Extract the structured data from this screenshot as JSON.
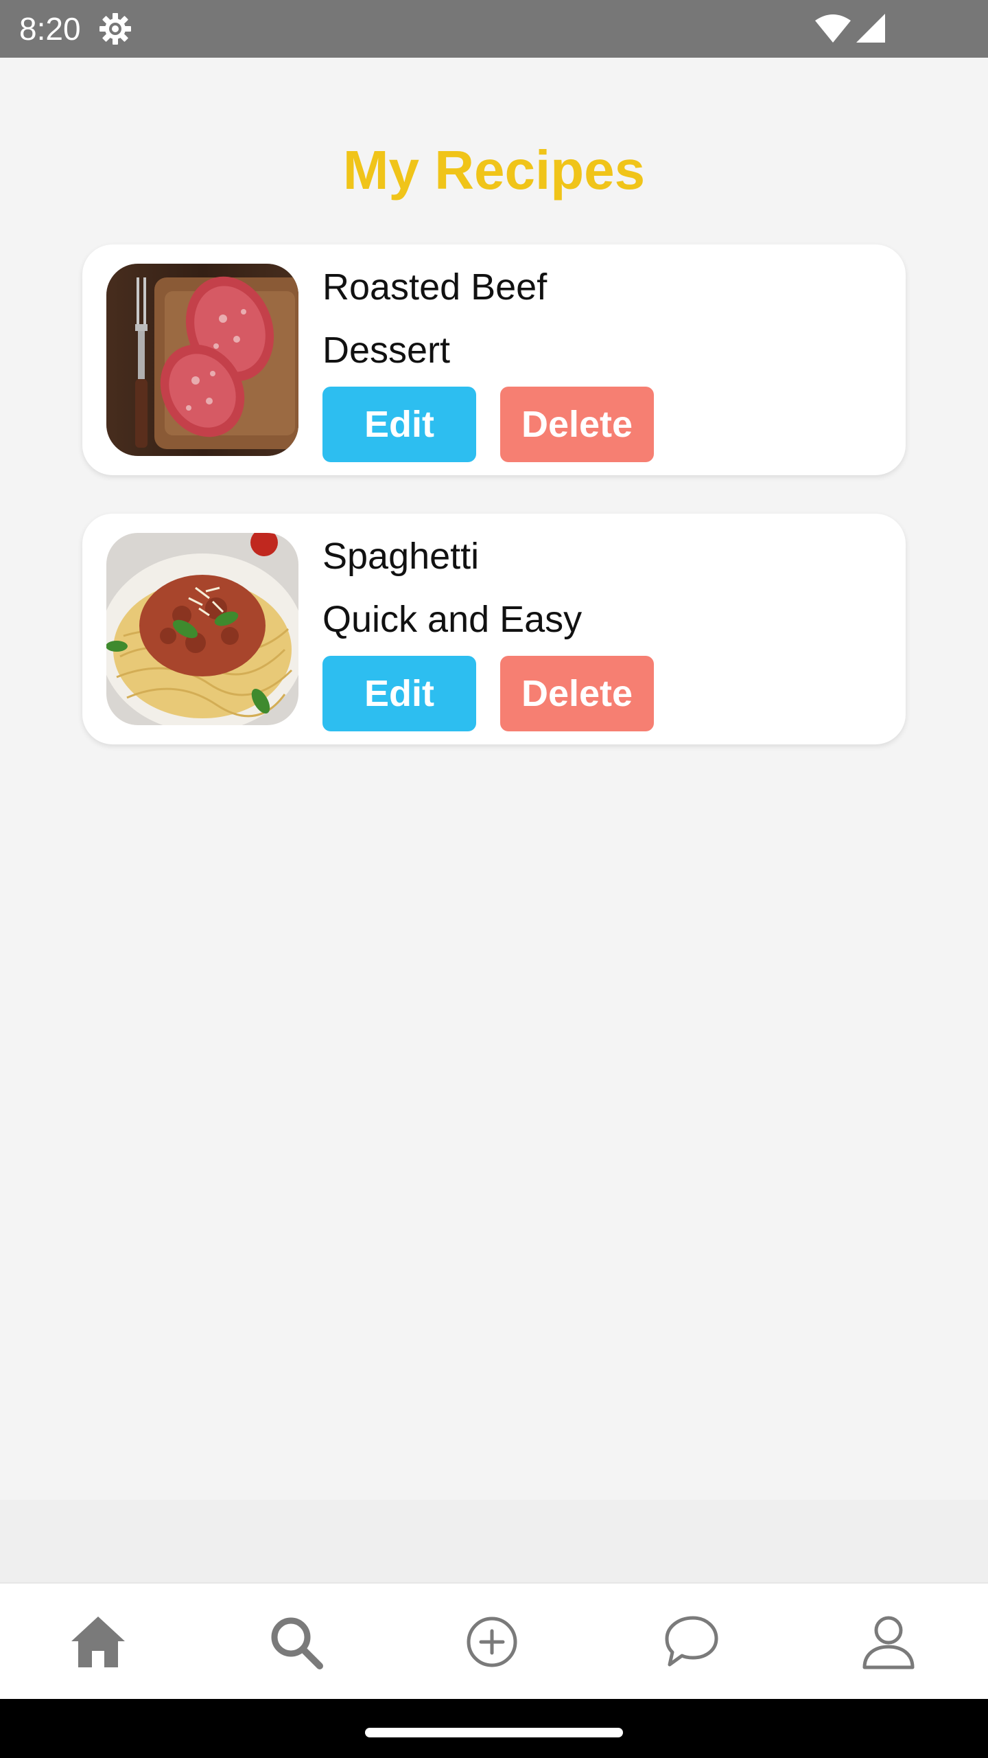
{
  "status_bar": {
    "time": "8:20",
    "icons": [
      "gear-icon",
      "wifi-icon",
      "signal-icon"
    ]
  },
  "page": {
    "title": "My Recipes",
    "title_color": "#f0c419"
  },
  "recipes": [
    {
      "name": "Roasted Beef",
      "category": "Dessert",
      "image": "raw-steaks-on-board",
      "edit_label": "Edit",
      "delete_label": "Delete"
    },
    {
      "name": "Spaghetti",
      "category": "Quick and Easy",
      "image": "spaghetti-bolognese",
      "edit_label": "Edit",
      "delete_label": "Delete"
    }
  ],
  "colors": {
    "edit_button": "#2dbef0",
    "delete_button": "#f67f72",
    "background": "#f4f4f4",
    "nav_icon": "#7a7a7a"
  },
  "bottom_nav": {
    "items": [
      "home-icon",
      "search-icon",
      "add-circle-icon",
      "chat-icon",
      "profile-icon"
    ],
    "active": "home-icon"
  }
}
